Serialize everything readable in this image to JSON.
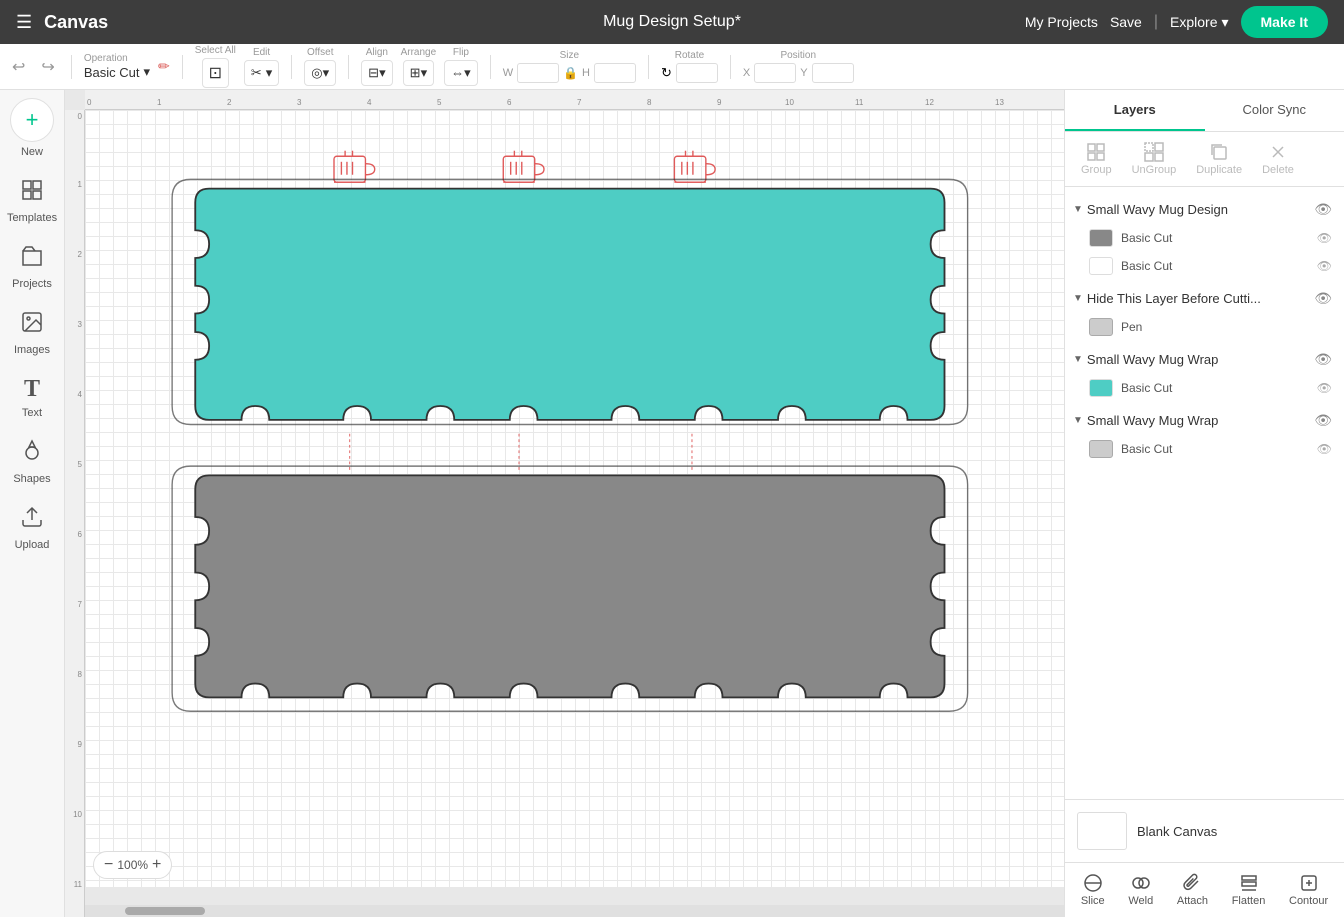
{
  "topnav": {
    "hamburger_icon": "☰",
    "logo": "Canvas",
    "title": "Mug Design Setup*",
    "my_projects": "My Projects",
    "save": "Save",
    "divider": "|",
    "explore": "Explore",
    "explore_chevron": "▾",
    "make_it": "Make It"
  },
  "toolbar": {
    "undo_icon": "↩",
    "redo_icon": "↪",
    "operation_label": "Operation",
    "operation_value": "Basic Cut",
    "edit_icon": "✏",
    "select_all_label": "Select All",
    "edit_label": "Edit",
    "offset_label": "Offset",
    "align_label": "Align",
    "arrange_label": "Arrange",
    "flip_label": "Flip",
    "size_label": "Size",
    "w_label": "W",
    "h_label": "H",
    "rotate_label": "Rotate",
    "position_label": "Position",
    "x_label": "X",
    "y_label": "Y",
    "chevron": "▾",
    "lock_icon": "🔒"
  },
  "sidebar": {
    "new_icon": "+",
    "new_label": "New",
    "items": [
      {
        "id": "templates",
        "icon": "⊞",
        "label": "Templates"
      },
      {
        "id": "projects",
        "icon": "📁",
        "label": "Projects"
      },
      {
        "id": "images",
        "icon": "🖼",
        "label": "Images"
      },
      {
        "id": "text",
        "icon": "T",
        "label": "Text"
      },
      {
        "id": "shapes",
        "icon": "◯",
        "label": "Shapes"
      },
      {
        "id": "upload",
        "icon": "⬆",
        "label": "Upload"
      }
    ]
  },
  "canvas": {
    "zoom": "100%",
    "zoom_minus": "−",
    "zoom_plus": "+"
  },
  "right_panel": {
    "tabs": [
      {
        "id": "layers",
        "label": "Layers",
        "active": true
      },
      {
        "id": "color_sync",
        "label": "Color Sync",
        "active": false
      }
    ],
    "toolbar": {
      "group_label": "Group",
      "ungroup_label": "UnGroup",
      "duplicate_label": "Duplicate",
      "delete_label": "Delete"
    },
    "layers": [
      {
        "id": "small_wavy_mug_design",
        "name": "Small Wavy Mug Design",
        "expanded": true,
        "children": [
          {
            "id": "basic_cut_gray",
            "name": "Basic Cut",
            "color": "#888888",
            "type": "basic_cut"
          },
          {
            "id": "basic_cut_outline",
            "name": "Basic Cut",
            "color": "#ffffff",
            "type": "basic_cut"
          }
        ]
      },
      {
        "id": "hide_layer",
        "name": "Hide This Layer Before Cutti...",
        "expanded": false,
        "children": [
          {
            "id": "pen",
            "name": "Pen",
            "color": "#cccccc",
            "type": "pen"
          }
        ]
      },
      {
        "id": "small_wavy_mug_wrap_teal",
        "name": "Small Wavy Mug Wrap",
        "expanded": true,
        "children": [
          {
            "id": "basic_cut_teal",
            "name": "Basic Cut",
            "color": "#4ecdc4",
            "type": "basic_cut"
          }
        ]
      },
      {
        "id": "small_wavy_mug_wrap_gray",
        "name": "Small Wavy Mug Wrap",
        "expanded": true,
        "children": [
          {
            "id": "basic_cut_gray2",
            "name": "Basic Cut",
            "color": "#cccccc",
            "type": "basic_cut"
          }
        ]
      }
    ],
    "blank_canvas_label": "Blank Canvas",
    "bottom_tools": [
      {
        "id": "slice",
        "icon": "⊘",
        "label": "Slice"
      },
      {
        "id": "weld",
        "icon": "⊕",
        "label": "Weld"
      },
      {
        "id": "attach",
        "icon": "📎",
        "label": "Attach"
      },
      {
        "id": "flatten",
        "icon": "⊟",
        "label": "Flatten"
      },
      {
        "id": "contour",
        "icon": "◈",
        "label": "Contour"
      }
    ]
  },
  "ruler": {
    "h_ticks": [
      "0",
      "1",
      "2",
      "3",
      "4",
      "5",
      "6",
      "7",
      "8",
      "9",
      "10",
      "11",
      "12",
      "13"
    ],
    "v_ticks": [
      "0",
      "1",
      "2",
      "3",
      "4",
      "5",
      "6",
      "7",
      "8",
      "9",
      "10",
      "11"
    ]
  }
}
